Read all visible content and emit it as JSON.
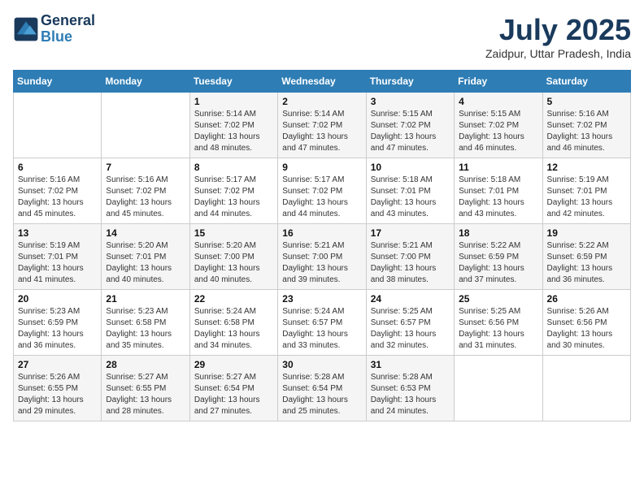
{
  "header": {
    "logo_line1": "General",
    "logo_line2": "Blue",
    "month": "July 2025",
    "location": "Zaidpur, Uttar Pradesh, India"
  },
  "weekdays": [
    "Sunday",
    "Monday",
    "Tuesday",
    "Wednesday",
    "Thursday",
    "Friday",
    "Saturday"
  ],
  "weeks": [
    [
      {
        "day": "",
        "info": ""
      },
      {
        "day": "",
        "info": ""
      },
      {
        "day": "1",
        "info": "Sunrise: 5:14 AM\nSunset: 7:02 PM\nDaylight: 13 hours and 48 minutes."
      },
      {
        "day": "2",
        "info": "Sunrise: 5:14 AM\nSunset: 7:02 PM\nDaylight: 13 hours and 47 minutes."
      },
      {
        "day": "3",
        "info": "Sunrise: 5:15 AM\nSunset: 7:02 PM\nDaylight: 13 hours and 47 minutes."
      },
      {
        "day": "4",
        "info": "Sunrise: 5:15 AM\nSunset: 7:02 PM\nDaylight: 13 hours and 46 minutes."
      },
      {
        "day": "5",
        "info": "Sunrise: 5:16 AM\nSunset: 7:02 PM\nDaylight: 13 hours and 46 minutes."
      }
    ],
    [
      {
        "day": "6",
        "info": "Sunrise: 5:16 AM\nSunset: 7:02 PM\nDaylight: 13 hours and 45 minutes."
      },
      {
        "day": "7",
        "info": "Sunrise: 5:16 AM\nSunset: 7:02 PM\nDaylight: 13 hours and 45 minutes."
      },
      {
        "day": "8",
        "info": "Sunrise: 5:17 AM\nSunset: 7:02 PM\nDaylight: 13 hours and 44 minutes."
      },
      {
        "day": "9",
        "info": "Sunrise: 5:17 AM\nSunset: 7:02 PM\nDaylight: 13 hours and 44 minutes."
      },
      {
        "day": "10",
        "info": "Sunrise: 5:18 AM\nSunset: 7:01 PM\nDaylight: 13 hours and 43 minutes."
      },
      {
        "day": "11",
        "info": "Sunrise: 5:18 AM\nSunset: 7:01 PM\nDaylight: 13 hours and 43 minutes."
      },
      {
        "day": "12",
        "info": "Sunrise: 5:19 AM\nSunset: 7:01 PM\nDaylight: 13 hours and 42 minutes."
      }
    ],
    [
      {
        "day": "13",
        "info": "Sunrise: 5:19 AM\nSunset: 7:01 PM\nDaylight: 13 hours and 41 minutes."
      },
      {
        "day": "14",
        "info": "Sunrise: 5:20 AM\nSunset: 7:01 PM\nDaylight: 13 hours and 40 minutes."
      },
      {
        "day": "15",
        "info": "Sunrise: 5:20 AM\nSunset: 7:00 PM\nDaylight: 13 hours and 40 minutes."
      },
      {
        "day": "16",
        "info": "Sunrise: 5:21 AM\nSunset: 7:00 PM\nDaylight: 13 hours and 39 minutes."
      },
      {
        "day": "17",
        "info": "Sunrise: 5:21 AM\nSunset: 7:00 PM\nDaylight: 13 hours and 38 minutes."
      },
      {
        "day": "18",
        "info": "Sunrise: 5:22 AM\nSunset: 6:59 PM\nDaylight: 13 hours and 37 minutes."
      },
      {
        "day": "19",
        "info": "Sunrise: 5:22 AM\nSunset: 6:59 PM\nDaylight: 13 hours and 36 minutes."
      }
    ],
    [
      {
        "day": "20",
        "info": "Sunrise: 5:23 AM\nSunset: 6:59 PM\nDaylight: 13 hours and 36 minutes."
      },
      {
        "day": "21",
        "info": "Sunrise: 5:23 AM\nSunset: 6:58 PM\nDaylight: 13 hours and 35 minutes."
      },
      {
        "day": "22",
        "info": "Sunrise: 5:24 AM\nSunset: 6:58 PM\nDaylight: 13 hours and 34 minutes."
      },
      {
        "day": "23",
        "info": "Sunrise: 5:24 AM\nSunset: 6:57 PM\nDaylight: 13 hours and 33 minutes."
      },
      {
        "day": "24",
        "info": "Sunrise: 5:25 AM\nSunset: 6:57 PM\nDaylight: 13 hours and 32 minutes."
      },
      {
        "day": "25",
        "info": "Sunrise: 5:25 AM\nSunset: 6:56 PM\nDaylight: 13 hours and 31 minutes."
      },
      {
        "day": "26",
        "info": "Sunrise: 5:26 AM\nSunset: 6:56 PM\nDaylight: 13 hours and 30 minutes."
      }
    ],
    [
      {
        "day": "27",
        "info": "Sunrise: 5:26 AM\nSunset: 6:55 PM\nDaylight: 13 hours and 29 minutes."
      },
      {
        "day": "28",
        "info": "Sunrise: 5:27 AM\nSunset: 6:55 PM\nDaylight: 13 hours and 28 minutes."
      },
      {
        "day": "29",
        "info": "Sunrise: 5:27 AM\nSunset: 6:54 PM\nDaylight: 13 hours and 27 minutes."
      },
      {
        "day": "30",
        "info": "Sunrise: 5:28 AM\nSunset: 6:54 PM\nDaylight: 13 hours and 25 minutes."
      },
      {
        "day": "31",
        "info": "Sunrise: 5:28 AM\nSunset: 6:53 PM\nDaylight: 13 hours and 24 minutes."
      },
      {
        "day": "",
        "info": ""
      },
      {
        "day": "",
        "info": ""
      }
    ]
  ]
}
